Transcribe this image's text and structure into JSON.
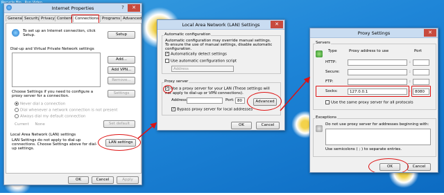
{
  "desktop": {
    "corner_label": "Recycle Bin",
    "corner_label2": "Run Video"
  },
  "internet_properties": {
    "title": "Internet Properties",
    "help": "?",
    "close": "✕",
    "tabs": [
      "General",
      "Security",
      "Privacy",
      "Content",
      "Connections",
      "Programs",
      "Advanced"
    ],
    "setup_text": "To set up an Internet connection, click Setup.",
    "setup_button": "Setup",
    "dialup_heading": "Dial-up and Virtual Private Network settings",
    "add_button": "Add...",
    "add_vpn_button": "Add VPN...",
    "remove_button": "Remove...",
    "settings_text": "Choose Settings if you need to configure a proxy server for a connection.",
    "settings_button": "Settings",
    "radio_never": "Never dial a connection",
    "radio_dial": "Dial whenever a network connection is not present",
    "radio_always": "Always dial my default connection",
    "current_label": "Current",
    "current_value": "None",
    "set_default_button": "Set default",
    "lan_heading": "Local Area Network (LAN) settings",
    "lan_text": "LAN Settings do not apply to dial-up connections. Choose Settings above for dial-up settings.",
    "lan_button": "LAN settings",
    "ok": "OK",
    "cancel": "Cancel",
    "apply": "Apply"
  },
  "lan_settings": {
    "title": "Local Area Network (LAN) Settings",
    "close": "✕",
    "auto_group": "Automatic configuration",
    "auto_text": "Automatic configuration may override manual settings. To ensure the use of manual settings, disable automatic configuration.",
    "auto_detect": "Automatically detect settings",
    "use_script": "Use automatic configuration script",
    "address_label": "Address",
    "proxy_group": "Proxy server",
    "use_proxy": "Use a proxy server for your LAN (These settings will not apply to dial-up or VPN connections).",
    "proxy_address_label": "Address:",
    "port_label": "Port:",
    "port_value": "80",
    "advanced_button": "Advanced",
    "bypass": "Bypass proxy server for local addresses",
    "ok": "OK",
    "cancel": "Cancel"
  },
  "proxy_settings": {
    "title": "Proxy Settings",
    "close": "✕",
    "servers_group": "Servers",
    "col_type": "Type",
    "col_address": "Proxy address to use",
    "col_port": "Port",
    "rows": [
      {
        "type": "HTTP:",
        "address": "",
        "port": ""
      },
      {
        "type": "Secure:",
        "address": "",
        "port": ""
      },
      {
        "type": "FTP:",
        "address": "",
        "port": ""
      },
      {
        "type": "Socks:",
        "address": "127.0.0.1",
        "port": "8080"
      }
    ],
    "sep": ":",
    "same_proxy": "Use the same proxy server for all protocols",
    "exceptions_group": "Exceptions",
    "exceptions_text": "Do not use proxy server for addresses beginning with:",
    "semicolons_text": "Use semicolons ( ; ) to separate entries.",
    "ok": "OK",
    "cancel": "Cancel"
  },
  "colors": {
    "annotation": "#dd1111",
    "titlebar": "#c9dcf1",
    "close": "#c74a3e",
    "desktop": "#1f86d8"
  }
}
